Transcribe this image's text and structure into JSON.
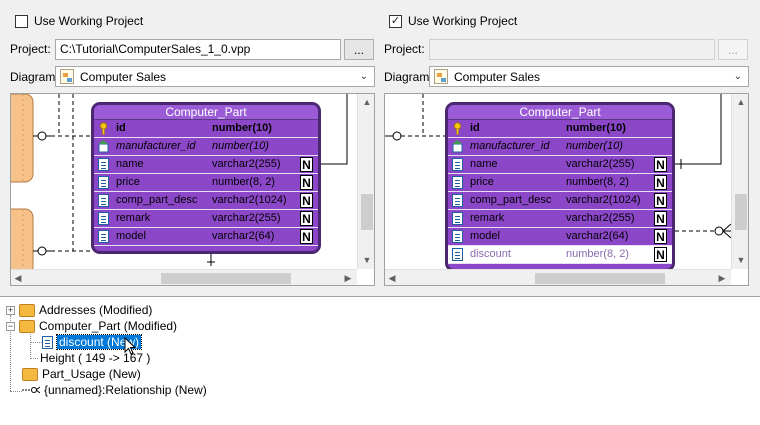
{
  "left": {
    "use_working_project": {
      "label": "Use Working Project",
      "checked": false
    },
    "project_label": "Project:",
    "project_value": "C:\\Tutorial\\ComputerSales_1_0.vpp",
    "browse_label": "...",
    "diagram_label": "Diagram:",
    "diagram_value": "Computer Sales",
    "entity": {
      "title": "Computer_Part",
      "columns": [
        {
          "name": "id",
          "type": "number(10)",
          "nn": ""
        },
        {
          "name": "manufacturer_id",
          "type": "number(10)",
          "nn": ""
        },
        {
          "name": "name",
          "type": "varchar2(255)",
          "nn": "N"
        },
        {
          "name": "price",
          "type": "number(8, 2)",
          "nn": "N"
        },
        {
          "name": "comp_part_desc",
          "type": "varchar2(1024)",
          "nn": "N"
        },
        {
          "name": "remark",
          "type": "varchar2(255)",
          "nn": "N"
        },
        {
          "name": "model",
          "type": "varchar2(64)",
          "nn": "N"
        }
      ]
    }
  },
  "right": {
    "use_working_project": {
      "label": "Use Working Project",
      "checked": true
    },
    "project_label": "Project:",
    "project_value": "",
    "browse_label": "...",
    "diagram_label": "Diagram:",
    "diagram_value": "Computer Sales",
    "entity": {
      "title": "Computer_Part",
      "columns": [
        {
          "name": "id",
          "type": "number(10)",
          "nn": ""
        },
        {
          "name": "manufacturer_id",
          "type": "number(10)",
          "nn": ""
        },
        {
          "name": "name",
          "type": "varchar2(255)",
          "nn": "N"
        },
        {
          "name": "price",
          "type": "number(8, 2)",
          "nn": "N"
        },
        {
          "name": "comp_part_desc",
          "type": "varchar2(1024)",
          "nn": "N"
        },
        {
          "name": "remark",
          "type": "varchar2(255)",
          "nn": "N"
        },
        {
          "name": "model",
          "type": "varchar2(64)",
          "nn": "N"
        },
        {
          "name": "discount",
          "type": "number(8, 2)",
          "nn": "N"
        }
      ]
    }
  },
  "tree": {
    "addresses": "Addresses (Modified)",
    "computer_part": "Computer_Part (Modified)",
    "discount": "discount (New)",
    "height": "Height ( 149 -> 167 )",
    "part_usage": "Part_Usage (New)",
    "relationship": "{unnamed}:Relationship (New)"
  },
  "colors": {
    "entity_fill": "#8c47c9",
    "entity_border": "#4a2770",
    "selection": "#0078d7"
  }
}
